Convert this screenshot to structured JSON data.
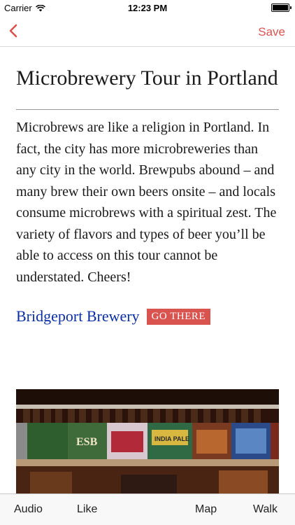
{
  "status_bar": {
    "carrier": "Carrier",
    "time": "12:23 PM"
  },
  "nav": {
    "save_label": "Save"
  },
  "tour": {
    "title": "Microbrewery Tour in Portland",
    "description": "Microbrews are like a religion in Portland. In fact, the city has more microbreweries than any city in the world. Brewpubs abound – and many brew their own beers onsite – and locals consume microbrews with a spiritual zest. The variety of flavors and types of beer you’ll be able to access on this tour cannot be understated. Cheers!"
  },
  "stop": {
    "name": "Bridgeport Brewery",
    "go_label": "GO THERE",
    "photo_labels": {
      "esb": "ESB",
      "ipa": "INDIA PALE"
    }
  },
  "tabs": {
    "audio": "Audio",
    "like": "Like",
    "map": "Map",
    "walk": "Walk"
  },
  "colors": {
    "accent": "#d9534f",
    "link": "#0b2ea4"
  }
}
